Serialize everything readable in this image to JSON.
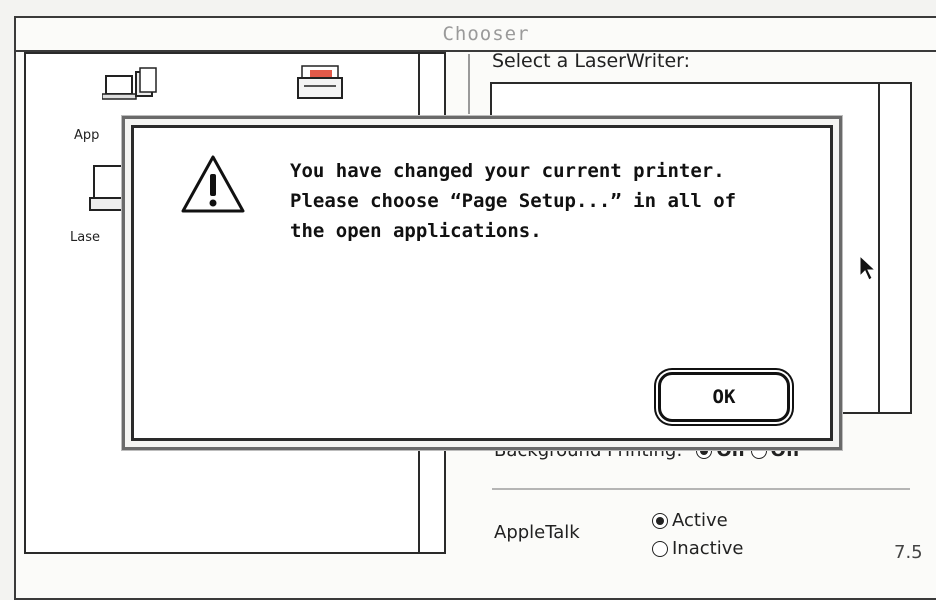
{
  "window": {
    "title": "Chooser"
  },
  "devices": [
    {
      "label": "App",
      "icon": "appleshare-icon"
    },
    {
      "label": "Lase",
      "icon": "laserwriter-icon"
    },
    {
      "label": "",
      "icon": "printer-icon"
    }
  ],
  "printer_panel": {
    "select_label": "Select a LaserWriter:"
  },
  "background_printing": {
    "label": "Background Printing:",
    "on_label": "On",
    "off_label": "Off",
    "selected": "On"
  },
  "appletalk": {
    "label": "AppleTalk",
    "active_label": "Active",
    "inactive_label": "Inactive",
    "selected": "Active"
  },
  "version": "7.5",
  "alert": {
    "icon": "caution-icon",
    "message": "You have changed your current printer. Please choose “Page Setup...” in all of the open applications.",
    "ok_label": "OK"
  }
}
